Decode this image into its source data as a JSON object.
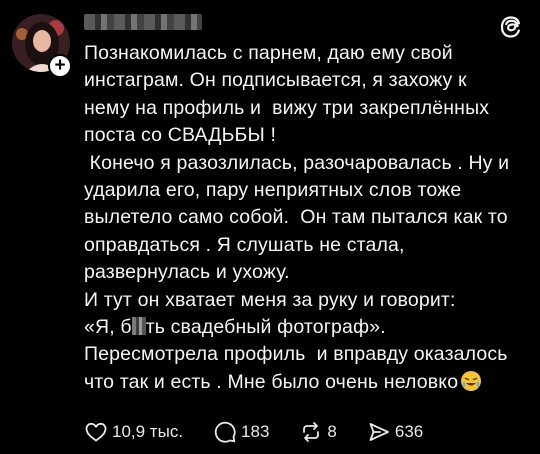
{
  "post": {
    "lines": [
      "Познакомилась с парнем, даю ему свой",
      "инстаграм. Он подписывается, я захожу к",
      "нему на профиль и  вижу три закреплённых",
      "поста со СВАДЬБЫ !",
      " Конечо я разозлилась, разочаровалась . Ну и",
      "ударила его, пару неприятных слов тоже",
      "вылетело само собой.  Он там пытался как то",
      "оправдаться . Я слушать не стала,",
      "развернулась и ухожу.",
      "И тут он хватает меня за руку и говорит:"
    ],
    "quote_start": "«Я, б",
    "quote_end": "ть свадебный фотограф».",
    "lines_after": [
      "Пересмотрела профиль  и вправду оказалось"
    ],
    "last_line": "что так и есть . Мне было очень неловко",
    "emoji_icon": "crying-laughing-emoji-icon"
  },
  "actions": {
    "likes": "10,9 тыс.",
    "comments": "183",
    "reposts": "8",
    "shares": "636"
  },
  "colors": {
    "background": "#000000",
    "text": "#f3f5f7"
  }
}
